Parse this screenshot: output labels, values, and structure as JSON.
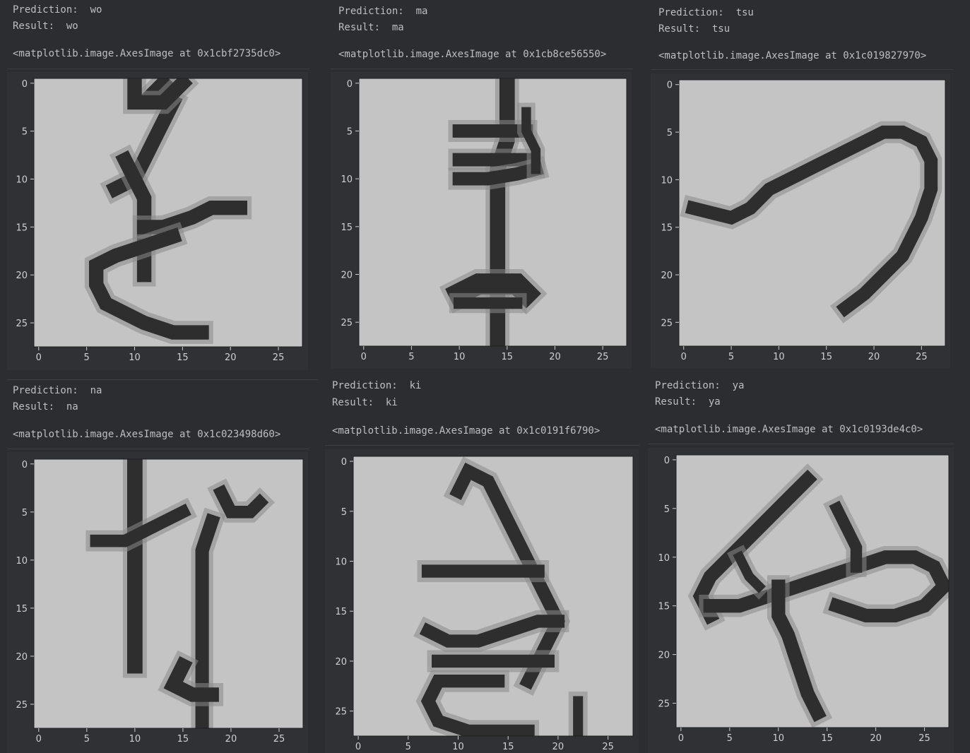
{
  "cells": [
    {
      "prediction_label": "Prediction:  wo",
      "result_label": "Result:  wo",
      "repr": "<matplotlib.image.AxesImage at 0x1cbf2735dc0>",
      "ticks": [
        "0",
        "5",
        "10",
        "15",
        "20",
        "25"
      ],
      "strokes": [
        {
          "w": 1.5,
          "pts": [
            [
              13,
              0
            ],
            [
              12,
              1
            ],
            [
              14,
              2
            ],
            [
              13,
              4
            ],
            [
              12,
              6
            ],
            [
              11,
              8
            ],
            [
              10,
              10
            ],
            [
              8,
              11
            ]
          ]
        },
        {
          "w": 1.5,
          "pts": [
            [
              10,
              0
            ],
            [
              10,
              2
            ],
            [
              13,
              2
            ],
            [
              15,
              0
            ]
          ]
        },
        {
          "w": 1.5,
          "pts": [
            [
              9,
              8
            ],
            [
              10,
              10
            ],
            [
              11,
              12
            ],
            [
              11,
              15
            ],
            [
              11,
              17
            ],
            [
              11,
              20
            ]
          ]
        },
        {
          "w": 1.5,
          "pts": [
            [
              11,
              15
            ],
            [
              13,
              15
            ],
            [
              16,
              14
            ],
            [
              18,
              13
            ],
            [
              21,
              13
            ]
          ]
        },
        {
          "w": 1.5,
          "pts": [
            [
              14,
              16
            ],
            [
              11,
              17
            ],
            [
              8,
              18
            ],
            [
              6,
              19
            ],
            [
              6,
              21
            ],
            [
              7,
              23
            ],
            [
              9,
              24
            ],
            [
              11,
              25
            ],
            [
              14,
              26
            ],
            [
              17,
              26
            ]
          ]
        }
      ]
    },
    {
      "prediction_label": "Prediction:  ma",
      "result_label": "Result:  ma",
      "repr": "<matplotlib.image.AxesImage at 0x1cb8ce56550>",
      "ticks": [
        "0",
        "5",
        "10",
        "15",
        "20",
        "25"
      ],
      "strokes": [
        {
          "w": 1.6,
          "pts": [
            [
              15,
              0
            ],
            [
              15,
              3
            ],
            [
              15,
              6
            ],
            [
              14,
              9
            ],
            [
              14,
              12
            ],
            [
              14,
              15
            ],
            [
              14,
              18
            ],
            [
              14,
              21
            ],
            [
              14,
              24
            ],
            [
              14,
              27
            ]
          ]
        },
        {
          "w": 1.4,
          "pts": [
            [
              10,
              5
            ],
            [
              13,
              5
            ],
            [
              15,
              5
            ],
            [
              17,
              5
            ]
          ]
        },
        {
          "w": 1.4,
          "pts": [
            [
              10,
              8
            ],
            [
              13,
              8
            ],
            [
              15,
              8
            ],
            [
              17,
              8
            ]
          ]
        },
        {
          "w": 1.4,
          "pts": [
            [
              10,
              10
            ],
            [
              13,
              10
            ],
            [
              16,
              9.5
            ],
            [
              18,
              9
            ]
          ]
        },
        {
          "w": 1.0,
          "pts": [
            [
              17,
              3
            ],
            [
              17,
              5
            ],
            [
              18,
              7
            ],
            [
              18,
              9
            ]
          ]
        },
        {
          "w": 2.2,
          "pts": [
            [
              10,
              22
            ],
            [
              12,
              21
            ],
            [
              14,
              21
            ],
            [
              16,
              21
            ],
            [
              17,
              22
            ]
          ]
        },
        {
          "w": 1.2,
          "pts": [
            [
              10,
              23
            ],
            [
              13,
              23
            ],
            [
              16,
              23
            ]
          ]
        }
      ]
    },
    {
      "prediction_label": "Prediction:  tsu",
      "result_label": "Result:  tsu",
      "repr": "<matplotlib.image.AxesImage at 0x1c019827970>",
      "ticks": [
        "0",
        "5",
        "10",
        "15",
        "20",
        "25"
      ],
      "strokes": [
        {
          "w": 1.4,
          "pts": [
            [
              1,
              13
            ],
            [
              3,
              13.5
            ],
            [
              5,
              14
            ],
            [
              7,
              13
            ],
            [
              9,
              11
            ],
            [
              11,
              10
            ],
            [
              13,
              9
            ],
            [
              15,
              8
            ],
            [
              17,
              7
            ],
            [
              19,
              6
            ],
            [
              21,
              5
            ],
            [
              23,
              5
            ],
            [
              25,
              6
            ],
            [
              26,
              8
            ],
            [
              26,
              11
            ],
            [
              25,
              14
            ],
            [
              24,
              16
            ],
            [
              23,
              18
            ],
            [
              21,
              20
            ],
            [
              19,
              22
            ],
            [
              17,
              23.5
            ]
          ]
        }
      ]
    },
    {
      "prediction_label": "Prediction:  na",
      "result_label": "Result:  na",
      "repr": "<matplotlib.image.AxesImage at 0x1c023498d60>",
      "ticks": [
        "0",
        "5",
        "10",
        "15",
        "20",
        "25"
      ],
      "strokes": [
        {
          "w": 1.6,
          "pts": [
            [
              10,
              0
            ],
            [
              10,
              3
            ],
            [
              10,
              6
            ],
            [
              10,
              9
            ],
            [
              10,
              12
            ],
            [
              10,
              15
            ],
            [
              10,
              18
            ],
            [
              10,
              21
            ]
          ]
        },
        {
          "w": 1.3,
          "pts": [
            [
              6,
              8
            ],
            [
              9,
              8
            ],
            [
              11,
              7
            ],
            [
              13,
              6
            ],
            [
              15,
              5
            ]
          ]
        },
        {
          "w": 1.3,
          "pts": [
            [
              19,
              3
            ],
            [
              20,
              5
            ],
            [
              22,
              5
            ],
            [
              23,
              4
            ]
          ]
        },
        {
          "w": 1.4,
          "pts": [
            [
              18,
              6
            ],
            [
              17,
              9
            ],
            [
              17,
              12
            ],
            [
              17,
              15
            ],
            [
              17,
              18
            ],
            [
              17,
              21
            ],
            [
              17,
              24
            ],
            [
              17,
              27
            ]
          ]
        },
        {
          "w": 1.5,
          "pts": [
            [
              15,
              21
            ],
            [
              14,
              23
            ],
            [
              16,
              24
            ],
            [
              18,
              24
            ]
          ]
        }
      ]
    },
    {
      "prediction_label": "Prediction:  ki",
      "result_label": "Result:  ki",
      "repr": "<matplotlib.image.AxesImage at 0x1c0191f6790>",
      "ticks": [
        "0",
        "5",
        "10",
        "15",
        "20",
        "25"
      ],
      "strokes": [
        {
          "w": 1.3,
          "pts": [
            [
              10,
              3
            ],
            [
              11,
              1
            ],
            [
              13,
              2
            ],
            [
              14,
              4
            ],
            [
              15,
              6
            ],
            [
              16,
              8
            ],
            [
              17,
              10
            ],
            [
              18,
              12
            ],
            [
              19,
              14
            ],
            [
              20,
              16
            ],
            [
              19,
              18
            ],
            [
              18,
              20
            ],
            [
              17,
              22
            ]
          ]
        },
        {
          "w": 1.3,
          "pts": [
            [
              7,
              11
            ],
            [
              10,
              11
            ],
            [
              13,
              11
            ],
            [
              16,
              11
            ],
            [
              18,
              11
            ]
          ]
        },
        {
          "w": 1.3,
          "pts": [
            [
              7,
              17
            ],
            [
              9,
              18
            ],
            [
              12,
              18
            ],
            [
              15,
              17
            ],
            [
              18,
              16
            ],
            [
              20,
              16
            ]
          ]
        },
        {
          "w": 1.3,
          "pts": [
            [
              8,
              20
            ],
            [
              11,
              20
            ],
            [
              14,
              20
            ],
            [
              17,
              20
            ],
            [
              19,
              20
            ]
          ]
        },
        {
          "w": 1.3,
          "pts": [
            [
              14,
              22
            ],
            [
              11,
              22
            ],
            [
              8,
              22
            ],
            [
              7,
              24
            ],
            [
              8,
              26
            ],
            [
              11,
              27
            ],
            [
              14,
              27
            ],
            [
              17,
              27
            ]
          ]
        },
        {
          "w": 1.0,
          "pts": [
            [
              22,
              24
            ],
            [
              22,
              27
            ]
          ]
        }
      ]
    },
    {
      "prediction_label": "Prediction:  ya",
      "result_label": "Result:  ya",
      "repr": "<matplotlib.image.AxesImage at 0x1c0193de4c0>",
      "ticks": [
        "0",
        "5",
        "10",
        "15",
        "20",
        "25"
      ],
      "strokes": [
        {
          "w": 1.4,
          "pts": [
            [
              13,
              2
            ],
            [
              11,
              4
            ],
            [
              9,
              6
            ],
            [
              7,
              8
            ],
            [
              5,
              10
            ],
            [
              3,
              12
            ],
            [
              2,
              14
            ],
            [
              3,
              16
            ]
          ]
        },
        {
          "w": 1.4,
          "pts": [
            [
              3,
              15
            ],
            [
              6,
              15
            ],
            [
              9,
              14
            ],
            [
              12,
              13
            ],
            [
              15,
              12
            ],
            [
              18,
              11
            ],
            [
              21,
              10
            ],
            [
              24,
              10
            ],
            [
              26,
              11
            ],
            [
              27,
              13
            ],
            [
              25,
              15
            ],
            [
              22,
              16
            ],
            [
              19,
              16
            ],
            [
              16,
              15
            ]
          ]
        },
        {
          "w": 1.2,
          "pts": [
            [
              16,
              5
            ],
            [
              17,
              7
            ],
            [
              18,
              9
            ],
            [
              18,
              11
            ]
          ]
        },
        {
          "w": 1.4,
          "pts": [
            [
              10,
              13
            ],
            [
              10,
              16
            ],
            [
              11,
              18
            ],
            [
              12,
              21
            ],
            [
              13,
              24
            ],
            [
              14,
              26
            ]
          ]
        },
        {
          "w": 1.0,
          "pts": [
            [
              6,
              10
            ],
            [
              7,
              12
            ],
            [
              8,
              13
            ]
          ]
        }
      ]
    }
  ]
}
